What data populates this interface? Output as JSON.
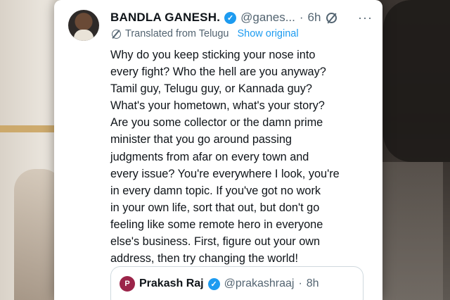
{
  "tweet": {
    "author_name": "BANDLA GANESH.",
    "handle": "@ganes...",
    "separator": "·",
    "time": "6h",
    "more": "···",
    "translated_label": "Translated from Telugu",
    "show_original_label": "Show original",
    "body_lines": [
      "Why do you keep sticking your nose into",
      "every fight? Who the hell are you anyway?",
      "Tamil guy, Telugu guy, or Kannada guy?",
      "What's your hometown, what's your story?",
      "Are you some collector or the damn prime",
      "minister that you go around passing",
      "judgments from afar on every town and",
      "every issue? You're everywhere I look, you're",
      "in every damn topic. If you've got no work",
      "in your own life, sort that out, but don't go",
      "feeling like some remote hero in everyone",
      "else's business. First, figure out your own",
      "address, then try changing the world!"
    ],
    "verified_mark": "✓"
  },
  "quoted_tweet": {
    "author_name": "Prakash Raj",
    "handle": "@prakashraaj",
    "separator": "·",
    "time": "8h",
    "verified_mark": "✓"
  },
  "icons": {
    "author_avatar": "avatar-photo",
    "verified": "verified-badge-icon",
    "grok": "grok-icon",
    "translate": "translate-globe-icon",
    "quoted_avatar": "avatar-photo"
  },
  "colors": {
    "link": "#1d9bf0",
    "verified": "#1d9bf0",
    "text_primary": "#0f1419",
    "text_secondary": "#536471"
  }
}
